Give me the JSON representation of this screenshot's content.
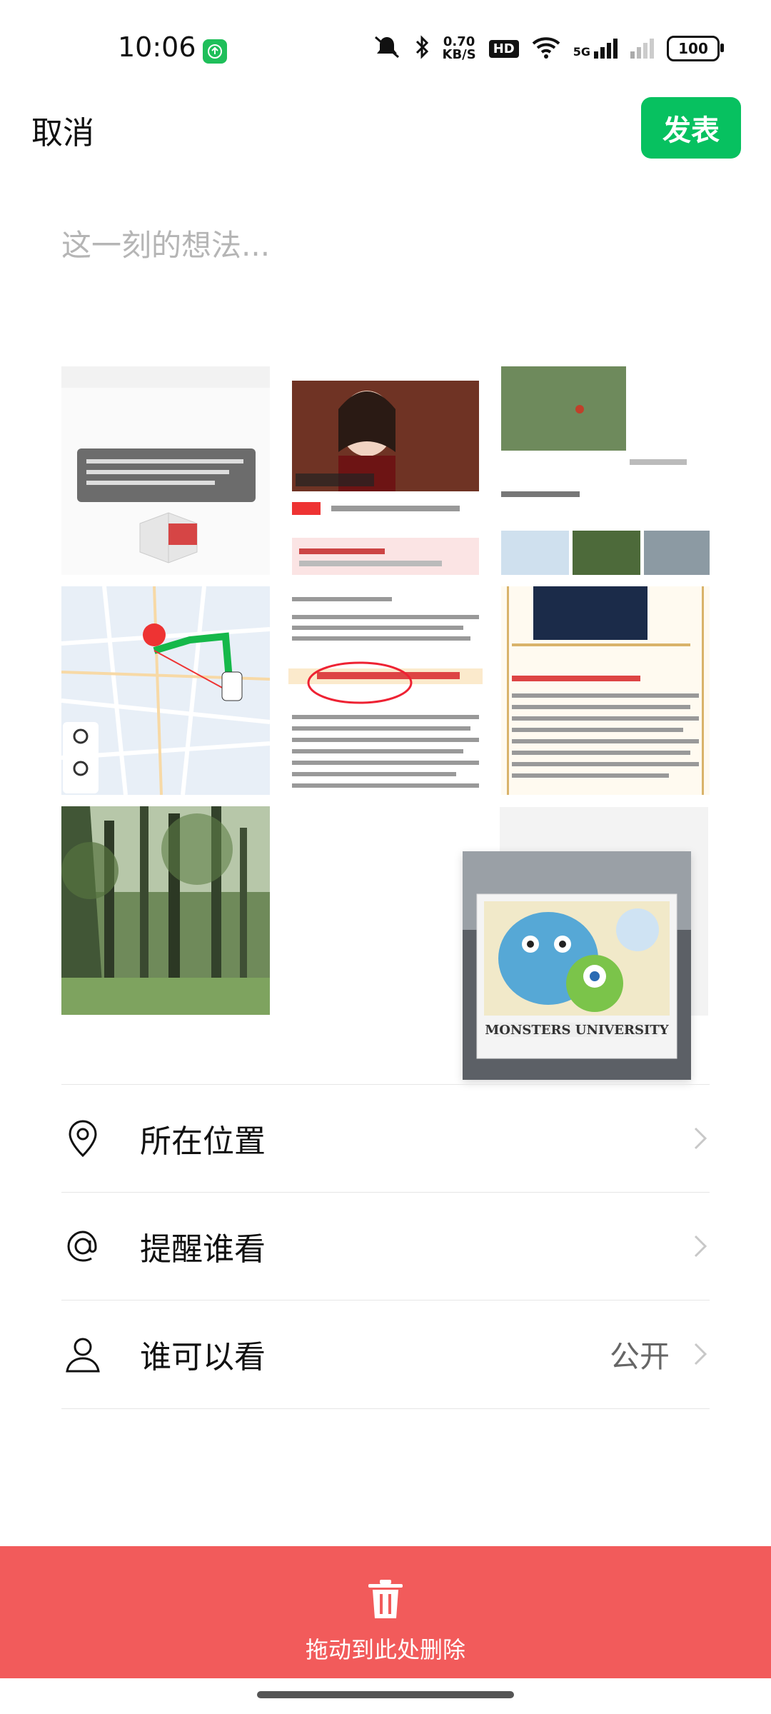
{
  "status_bar": {
    "time": "10:06",
    "speed_value": "0.70",
    "speed_unit": "KB/S",
    "hd_label": "HD",
    "network_label": "5G",
    "battery": "100"
  },
  "topbar": {
    "cancel_label": "取消",
    "publish_label": "发表"
  },
  "composer": {
    "placeholder": "这一刻的想法..."
  },
  "images": [
    {
      "name": "screenshot-dialog"
    },
    {
      "name": "news-article-screenshot"
    },
    {
      "name": "social-feed-screenshot"
    },
    {
      "name": "map-route-screenshot"
    },
    {
      "name": "document-text-screenshot"
    },
    {
      "name": "profile-document-screenshot"
    },
    {
      "name": "forest-photo"
    },
    {
      "name": "monsters-university-figure-photo"
    }
  ],
  "options": [
    {
      "label": "所在位置",
      "icon": "location-pin-icon",
      "value": ""
    },
    {
      "label": "提醒谁看",
      "icon": "at-icon",
      "value": ""
    },
    {
      "label": "谁可以看",
      "icon": "person-icon",
      "value": "公开"
    }
  ],
  "delete_zone": {
    "label": "拖动到此处删除",
    "icon": "trash-icon"
  },
  "colors": {
    "primary_green": "#07c160",
    "delete_red": "#f25b5b"
  }
}
